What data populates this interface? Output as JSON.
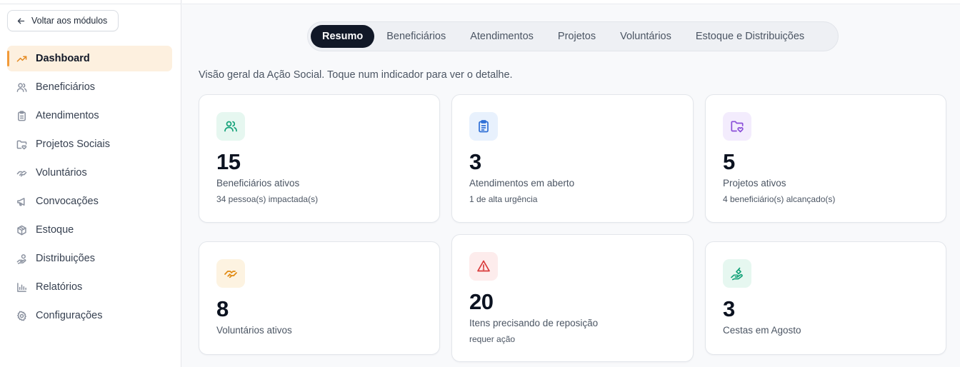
{
  "sidebar": {
    "back_label": "Voltar aos módulos",
    "items": [
      {
        "label": "Dashboard",
        "icon": "trending-up-icon"
      },
      {
        "label": "Beneficiários",
        "icon": "users-icon"
      },
      {
        "label": "Atendimentos",
        "icon": "clipboard-icon"
      },
      {
        "label": "Projetos Sociais",
        "icon": "folder-heart-icon"
      },
      {
        "label": "Voluntários",
        "icon": "handshake-icon"
      },
      {
        "label": "Convocações",
        "icon": "megaphone-icon"
      },
      {
        "label": "Estoque",
        "icon": "package-icon"
      },
      {
        "label": "Distribuições",
        "icon": "hand-coins-icon"
      },
      {
        "label": "Relatórios",
        "icon": "bar-chart-icon"
      },
      {
        "label": "Configurações",
        "icon": "gear-icon"
      }
    ],
    "active_index": 0
  },
  "tabs": [
    {
      "label": "Resumo"
    },
    {
      "label": "Beneficiários"
    },
    {
      "label": "Atendimentos"
    },
    {
      "label": "Projetos"
    },
    {
      "label": "Voluntários"
    },
    {
      "label": "Estoque e Distribuições"
    }
  ],
  "intro": "Visão geral da Ação Social. Toque num indicador para ver o detalhe.",
  "cards": [
    {
      "value": "15",
      "label": "Beneficiários ativos",
      "sub": "34 pessoa(s) impactada(s)",
      "icon": "users-icon",
      "icon_color": "#16a37a",
      "icon_bg": "#e6f7f0"
    },
    {
      "value": "3",
      "label": "Atendimentos em aberto",
      "sub": "1 de alta urgência",
      "icon": "clipboard-list-icon",
      "icon_color": "#2f6fd6",
      "icon_bg": "#e8f1fd"
    },
    {
      "value": "5",
      "label": "Projetos ativos",
      "sub": "4 beneficiário(s) alcançado(s)",
      "icon": "folder-heart-icon",
      "icon_color": "#8a4fd8",
      "icon_bg": "#f3ecfd"
    },
    {
      "value": "8",
      "label": "Voluntários ativos",
      "sub": "",
      "icon": "handshake-icon",
      "icon_color": "#e08a12",
      "icon_bg": "#fdf3e1"
    },
    {
      "value": "20",
      "label": "Itens precisando de reposição",
      "sub": "requer ação",
      "icon": "alert-triangle-icon",
      "icon_color": "#d93a3a",
      "icon_bg": "#fdecec"
    },
    {
      "value": "3",
      "label": "Cestas em Agosto",
      "sub": "",
      "icon": "hand-coins-icon",
      "icon_color": "#16a37a",
      "icon_bg": "#e6f7f0"
    }
  ]
}
